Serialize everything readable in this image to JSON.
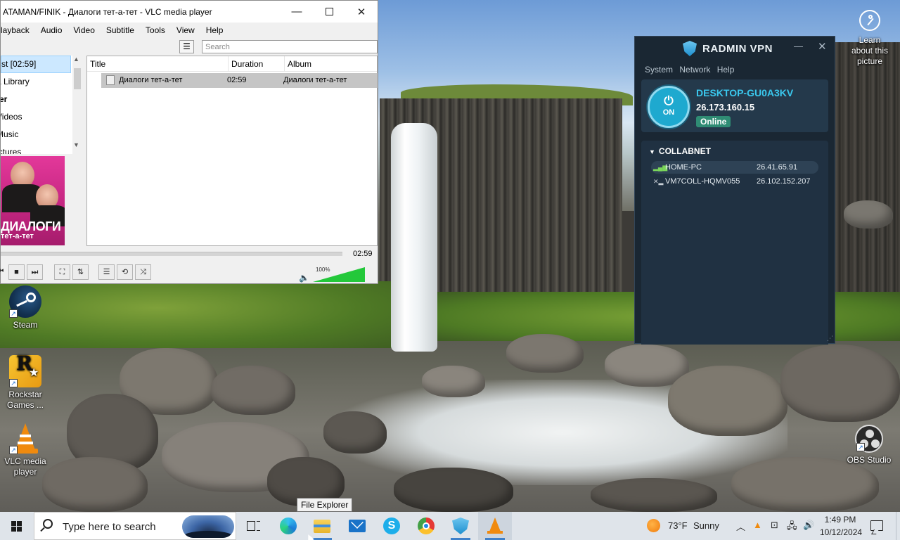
{
  "vlc": {
    "title": "ATAMAN/FINIK - Диалоги тет-а-тет - VLC media player",
    "menu": [
      "layback",
      "Audio",
      "Video",
      "Subtitle",
      "Tools",
      "View",
      "Help"
    ],
    "search_placeholder": "Search",
    "sidebar": [
      "st [02:59]",
      "a Library",
      "ter",
      "Videos",
      "Music",
      "ictures"
    ],
    "album_art": {
      "title": "ДИАЛОГИ",
      "subtitle": "тет-а-тет"
    },
    "columns": [
      "Title",
      "Duration",
      "Album"
    ],
    "row": {
      "title": "Диалоги тет-а-тет",
      "duration": "02:59",
      "album": "Диалоги тет-а-тет"
    },
    "elapsed": "02:59",
    "volume_label": "100%",
    "volume_fraction": 1.0,
    "controls": {
      "prev": "⏮",
      "stop": "■",
      "next": "⏭",
      "fullscreen": "⛶",
      "extended": "⇅",
      "playlist": "☰",
      "loop": "⟲",
      "shuffle": "⤨"
    }
  },
  "radmin": {
    "logo": "RADMIN VPN",
    "menu": [
      "System",
      "Network",
      "Help"
    ],
    "power_label": "ON",
    "hostname": "DESKTOP-GU0A3KV",
    "ip": "26.173.160.15",
    "status": "Online",
    "network": "COLLABNET",
    "peers": [
      {
        "name": "HOME-PC",
        "ip": "26.41.65.91"
      },
      {
        "name": "VM7COLL-HQMV055",
        "ip": "26.102.152.207"
      }
    ]
  },
  "desktop": {
    "icons": [
      {
        "label": "Steam"
      },
      {
        "label": "Rockstar Games ..."
      },
      {
        "label": "VLC media player"
      }
    ],
    "learn_about": "Learn about this picture",
    "obs_label": "OBS Studio"
  },
  "tooltip": "File Explorer",
  "taskbar": {
    "search_text": "Type here to search",
    "temperature": "73°F",
    "condition": "Sunny",
    "time": "1:49 PM",
    "date": "10/12/2024"
  },
  "colors": {
    "vpn_accent": "#3ac8ee",
    "vpn_online": "#2f8c74",
    "vlc_volume": "#23c83a",
    "album_art": "#c2257f"
  }
}
